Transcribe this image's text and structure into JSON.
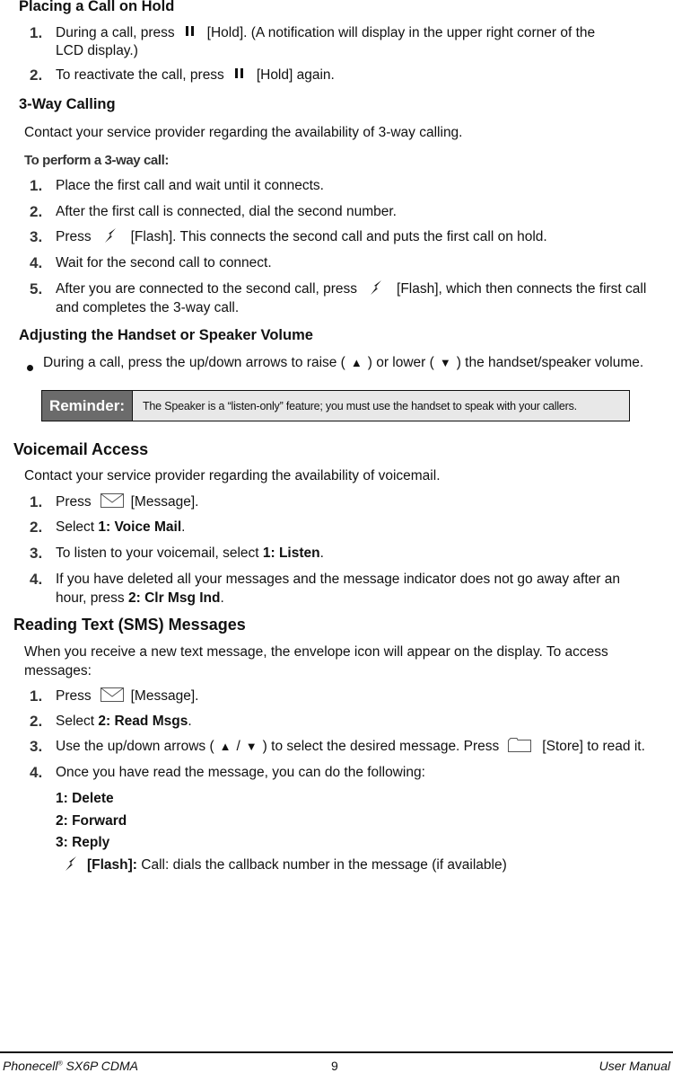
{
  "hold_section": {
    "title": "Placing a Call on Hold",
    "steps": [
      {
        "num": "1.",
        "before": "During a call, press",
        "icon": "hold-icon",
        "after": "[Hold]. (A notification will display in the upper right corner of the",
        "line2": "LCD display.)"
      },
      {
        "num": "2.",
        "before": "To reactivate the call, press",
        "icon": "hold-icon",
        "after": "[Hold] again."
      }
    ]
  },
  "threeway_section": {
    "title": "3-Way Calling",
    "intro": "Contact your service provider regarding the availability of 3-way calling.",
    "subheading": "To perform a 3-way call:",
    "steps": [
      {
        "num": "1.",
        "text": "Place the first call and wait until it connects."
      },
      {
        "num": "2.",
        "text": "After the first call is connected, dial the second number."
      },
      {
        "num": "3.",
        "before": "Press",
        "icon": "flash-icon",
        "after": "[Flash]. This connects the second call and puts the first call on hold."
      },
      {
        "num": "4.",
        "text": "Wait for the second call to connect."
      },
      {
        "num": "5.",
        "before": "After you are connected to the second call, press",
        "icon": "flash-icon",
        "after": "[Flash], which then connects the first call",
        "line2": "and completes the 3-way call."
      }
    ]
  },
  "volume_section": {
    "title": "Adjusting the Handset or Speaker Volume",
    "bullet": {
      "part1": "During a call, press the up/down arrows to raise (",
      "up": "▲",
      "part2": ") or lower (",
      "down": "▼",
      "part3": ") the handset/speaker volume."
    }
  },
  "reminder": {
    "label": "Reminder:",
    "text": "The Speaker is a “listen-only” feature; you must use the handset to speak with your callers."
  },
  "voicemail_section": {
    "title": "Voicemail Access",
    "intro": "Contact your service provider regarding the availability of voicemail.",
    "steps": [
      {
        "num": "1.",
        "before": "Press",
        "icon": "envelope-icon",
        "after": "[Message]."
      },
      {
        "num": "2.",
        "before": "Select ",
        "bold": "1: Voice Mail",
        "after": "."
      },
      {
        "num": "3.",
        "before": "To listen to your voicemail, select ",
        "bold": "1: Listen",
        "after": "."
      },
      {
        "num": "4.",
        "text": "If you have deleted all your messages and the message indicator does not go away after an",
        "line2_before": "hour, press ",
        "line2_bold": "2: Clr Msg Ind",
        "line2_after": "."
      }
    ]
  },
  "sms_section": {
    "title": "Reading Text (SMS) Messages",
    "intro": "When you receive a new text message, the envelope icon will appear on the display. To access",
    "intro_line2": "messages:",
    "steps": [
      {
        "num": "1.",
        "before": "Press",
        "icon": "envelope-icon",
        "after": "[Message]."
      },
      {
        "num": "2.",
        "before": "Select ",
        "bold": "2: Read Msgs",
        "after": "."
      },
      {
        "num": "3.",
        "before": "Use the up/down arrows (",
        "up": "▲",
        "slash": "/",
        "down": "▼",
        "mid": ") to select the desired message. Press",
        "icon": "folder-icon",
        "after": "[Store] to read it."
      },
      {
        "num": "4.",
        "text": "Once you have read the message, you can do the following:"
      }
    ],
    "options": [
      "1: Delete",
      "2: Forward",
      "3: Reply"
    ],
    "flash_option": {
      "label": "[Flash]:",
      "text": " Call: dials the callback number in the message (if available)"
    }
  },
  "footer": {
    "product": "Phonecell",
    "reg": "®",
    "model": " SX6P CDMA",
    "page": "9",
    "doc": "User Manual"
  }
}
